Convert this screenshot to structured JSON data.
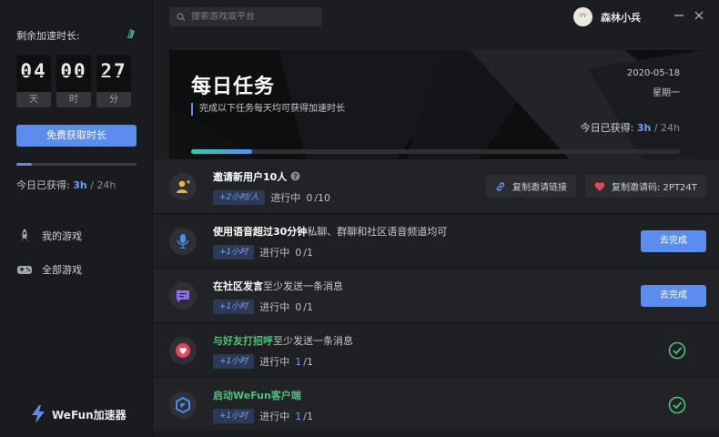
{
  "sidebar": {
    "remain_label": "剩余加速时长:",
    "timer": [
      {
        "value": "04",
        "unit": "天"
      },
      {
        "value": "00",
        "unit": "时"
      },
      {
        "value": "27",
        "unit": "分"
      }
    ],
    "free_button": "免费获取时长",
    "progress_fraction": 0.125,
    "earned_label": "今日已获得:",
    "earned_value": "3h",
    "earned_total": "/ 24h",
    "nav": [
      {
        "label": "我的游戏",
        "icon": "rocket-icon"
      },
      {
        "label": "全部游戏",
        "icon": "gamepad-icon"
      }
    ],
    "brand": "WeFun加速器"
  },
  "topbar": {
    "search_placeholder": "搜索游戏或平台",
    "username": "森林小兵"
  },
  "banner": {
    "title": "每日任务",
    "subtitle": "完成以下任务每天均可获得加速时长",
    "date": "2020-05-18",
    "weekday": "星期一",
    "earned_label": "今日已获得:",
    "earned_value": "3h",
    "earned_total": "/ 24h",
    "progress_fraction": 0.125
  },
  "tasks": [
    {
      "title_bold": "邀请新用户10人",
      "title_rest": "",
      "reward": "+2小时/人",
      "progress_label": "进行中",
      "done": "0",
      "total": "/10",
      "buttons": [
        {
          "label": "复制邀请链接",
          "icon": "link-icon"
        },
        {
          "label": "复制邀请码: 2PT24T",
          "icon": "heart-icon"
        }
      ]
    },
    {
      "title_bold": "使用语音超过30分钟",
      "title_rest": "私聊、群聊和社区语音频道均可",
      "reward": "+1小时",
      "progress_label": "进行中",
      "done": "0",
      "total": "/1",
      "go_label": "去完成"
    },
    {
      "title_bold": "在社区发言",
      "title_rest": "至少发送一条消息",
      "reward": "+1小时",
      "progress_label": "进行中",
      "done": "0",
      "total": "/1",
      "go_label": "去完成"
    },
    {
      "title_bold": "与好友打招呼",
      "title_rest": "至少发送一条消息",
      "reward": "+1小时",
      "progress_label": "进行中",
      "done": "1",
      "total": "/1"
    },
    {
      "title_bold": "启动WeFun客户端",
      "title_rest": "",
      "reward": "+1小时",
      "progress_label": "进行中",
      "done": "1",
      "total": "/1"
    }
  ],
  "colors": {
    "accent": "#5b8dee",
    "success": "#4dc27a",
    "danger": "#e8455a"
  }
}
